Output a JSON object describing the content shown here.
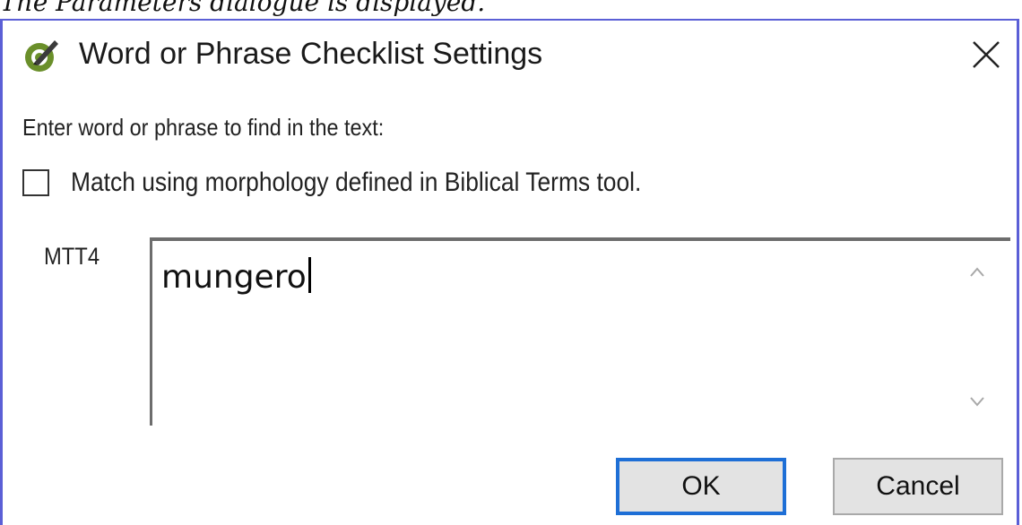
{
  "caption": "The Parameters dialogue is displayed.",
  "dialog": {
    "title": "Word or Phrase Checklist Settings",
    "prompt": "Enter word or phrase to find in the text:",
    "morphology_checkbox": {
      "label": "Match using morphology defined in Biblical Terms tool.",
      "checked": false
    },
    "field_label": "MTT4",
    "field_value": "mungero",
    "buttons": {
      "ok": "OK",
      "cancel": "Cancel"
    }
  },
  "icons": {
    "app": "paratext-check-icon",
    "close": "close-icon",
    "scroll_up": "chevron-up-icon",
    "scroll_down": "chevron-down-icon"
  },
  "colors": {
    "window_border": "#5b5fd6",
    "ok_focus": "#1e6fd6",
    "app_icon_green": "#6a8f2a"
  }
}
